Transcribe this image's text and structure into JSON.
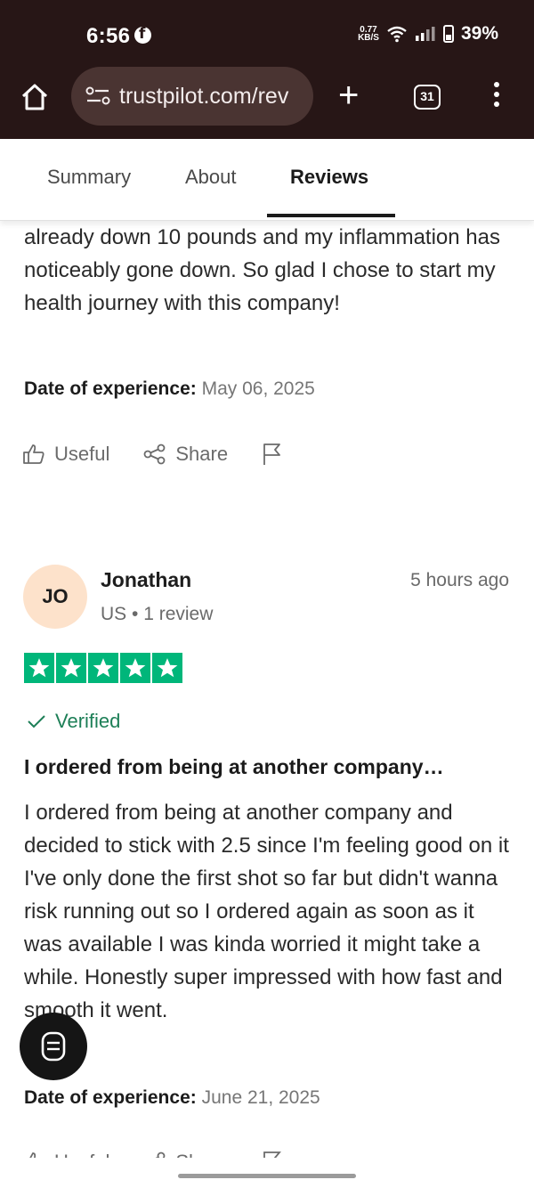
{
  "status_bar": {
    "time": "6:56",
    "net_speed_value": "0.77",
    "net_speed_unit": "KB/S",
    "battery": "39%"
  },
  "browser": {
    "url": "trustpilot.com/rev",
    "tab_count": "31"
  },
  "tabs": [
    {
      "label": "Summary",
      "active": false
    },
    {
      "label": "About",
      "active": false
    },
    {
      "label": "Reviews",
      "active": true
    }
  ],
  "previous_review": {
    "text_tail": "already down 10 pounds and my inflammation has noticeably gone down. So glad I chose to start my health journey with this company!",
    "date_label": "Date of experience:",
    "date_value": "May 06, 2025"
  },
  "actions": {
    "useful": "Useful",
    "share": "Share"
  },
  "review": {
    "initials": "JO",
    "name": "Jonathan",
    "meta": "US • 1 review",
    "time": "5 hours ago",
    "rating": 5,
    "verified": "Verified",
    "title": "I ordered from being at another company…",
    "body": "I ordered from being at another company and decided to stick with 2.5 since I'm feeling good on it I've only done the first shot so far but didn't wanna risk running out so I ordered again as soon as it was available I was kinda worried it might take a while. Honestly super impressed with how fast and smooth it went.",
    "date_label": "Date of experience:",
    "date_value": "June 21, 2025"
  },
  "colors": {
    "chrome": "#271616",
    "trustpilot_green": "#00b67a",
    "verified_green": "#1d7f57",
    "avatar_bg": "#fde2cb"
  }
}
